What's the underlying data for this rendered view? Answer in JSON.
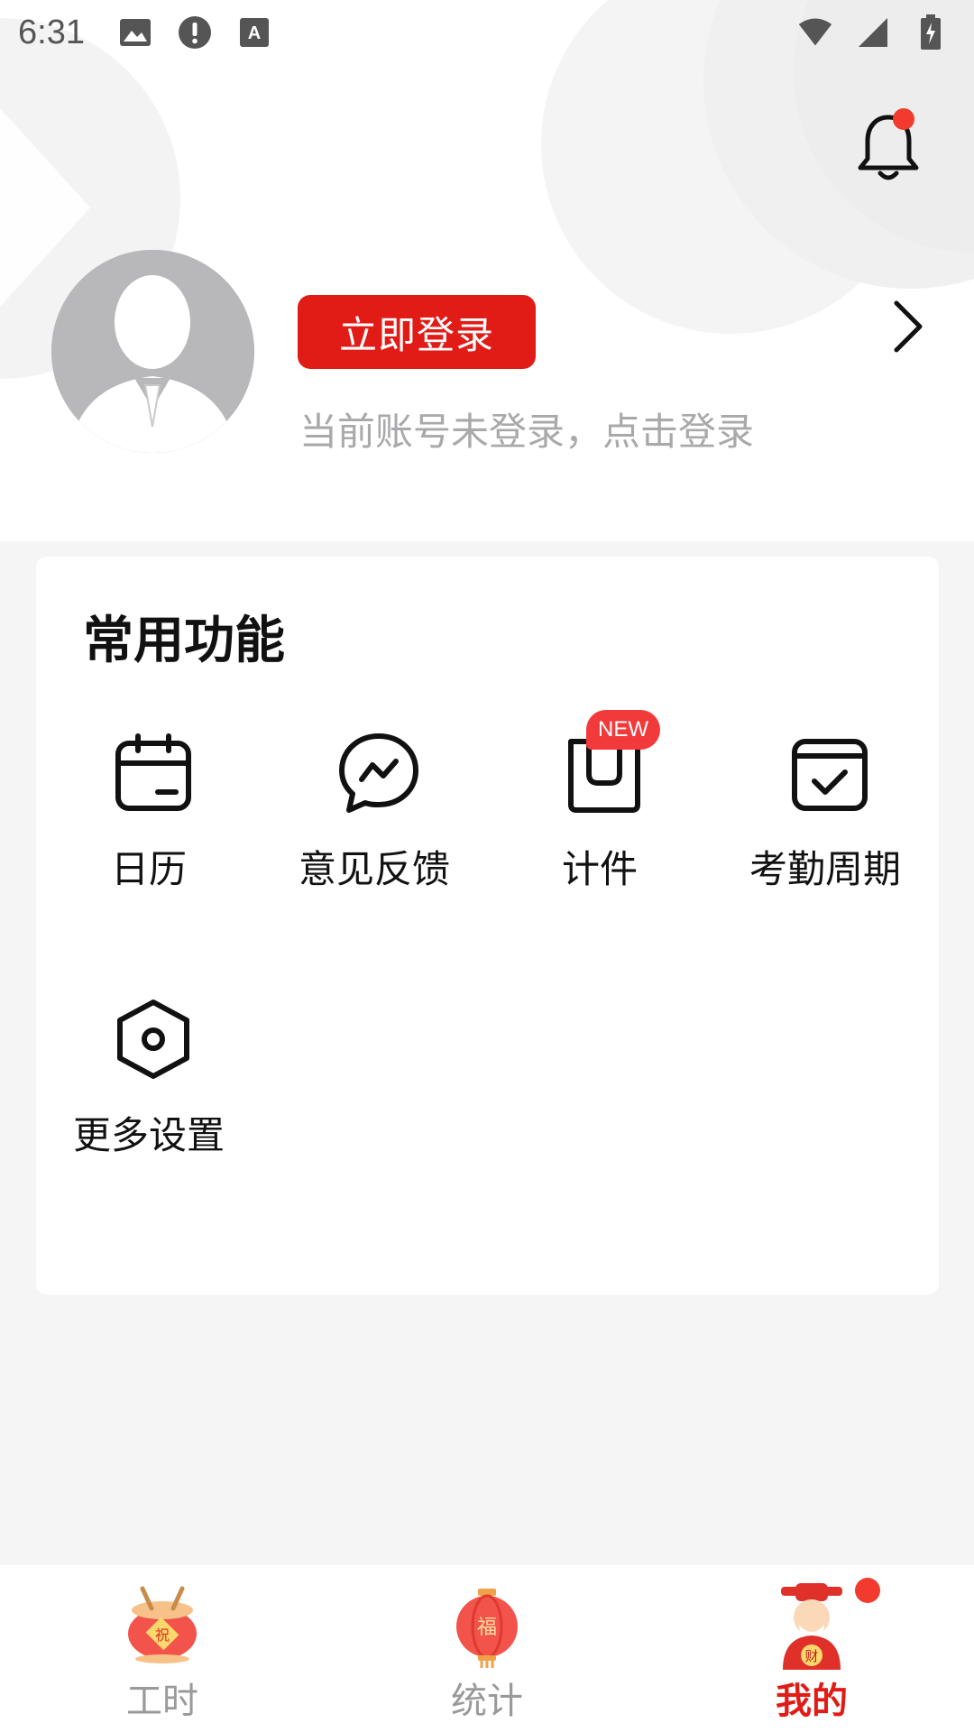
{
  "status_bar": {
    "time": "6:31",
    "icons": [
      "image-icon",
      "alert-icon",
      "keyboard-icon",
      "wifi-icon",
      "signal-icon",
      "battery-icon"
    ]
  },
  "header": {
    "bell_icon": "bell-icon",
    "has_notification": true,
    "login_button": "立即登录",
    "login_hint": "当前账号未登录，点击登录"
  },
  "functions": {
    "title": "常用功能",
    "items": [
      {
        "label": "日历",
        "icon": "calendar-icon"
      },
      {
        "label": "意见反馈",
        "icon": "feedback-icon"
      },
      {
        "label": "计件",
        "icon": "piecework-icon",
        "badge": "NEW"
      },
      {
        "label": "考勤周期",
        "icon": "attendance-cycle-icon"
      },
      {
        "label": "更多设置",
        "icon": "settings-icon"
      }
    ]
  },
  "bottom_nav": {
    "items": [
      {
        "label": "工时",
        "icon": "drum-icon",
        "active": false
      },
      {
        "label": "统计",
        "icon": "lantern-icon",
        "active": false
      },
      {
        "label": "我的",
        "icon": "fortune-god-icon",
        "active": true
      }
    ]
  },
  "colors": {
    "accent": "#e11b16",
    "badge": "#f23a3a",
    "background": "#f5f5f6",
    "muted_text": "#a9a9ab"
  }
}
